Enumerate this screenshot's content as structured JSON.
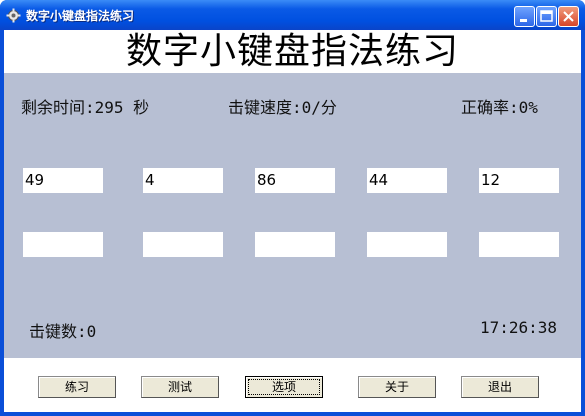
{
  "window": {
    "title": "数字小键盘指法练习"
  },
  "header": {
    "title": "数字小键盘指法练习"
  },
  "stats": {
    "remaining_time": "剩余时间:295 秒",
    "key_speed": "击键速度:0/分",
    "accuracy": "正确率:0%",
    "keystrokes": "击键数:0",
    "clock": "17:26:38"
  },
  "prompts": [
    "49",
    "4",
    "86",
    "44",
    "12"
  ],
  "answers": [
    "",
    "",
    "",
    "",
    ""
  ],
  "buttons": {
    "practice": "练习",
    "test": "测试",
    "options": "选项",
    "about": "关于",
    "exit": "退出"
  },
  "icons": {
    "app": "gear-icon",
    "minimize": "minimize-icon",
    "maximize": "maximize-icon",
    "close": "close-icon"
  },
  "colors": {
    "titlebar": "#0050e0",
    "client_background": "#b7bfd3",
    "close_button": "#d8452a"
  }
}
